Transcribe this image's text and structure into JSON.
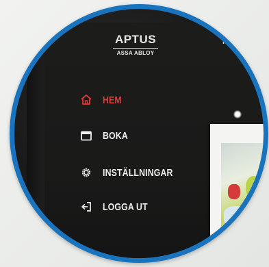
{
  "brand": {
    "logo_text": "APTUS",
    "logo_subtitle": "ASSA ABLOY"
  },
  "header": {
    "right_text": "HE"
  },
  "menu": {
    "items": [
      {
        "label": "HEM",
        "icon": "home-icon",
        "active": true,
        "color": "#e23a3a"
      },
      {
        "label": "BOKA",
        "icon": "calendar-icon",
        "active": false,
        "color": "#efefef"
      },
      {
        "label": "INSTÄLLNINGAR",
        "icon": "gear-icon",
        "active": false,
        "color": "#efefef"
      },
      {
        "label": "LOGGA UT",
        "icon": "logout-icon",
        "active": false,
        "color": "#efefef"
      }
    ]
  },
  "colors": {
    "frame_ring": "#1a73bd",
    "screen_bg": "#1a1a19",
    "active": "#e23a3a"
  }
}
